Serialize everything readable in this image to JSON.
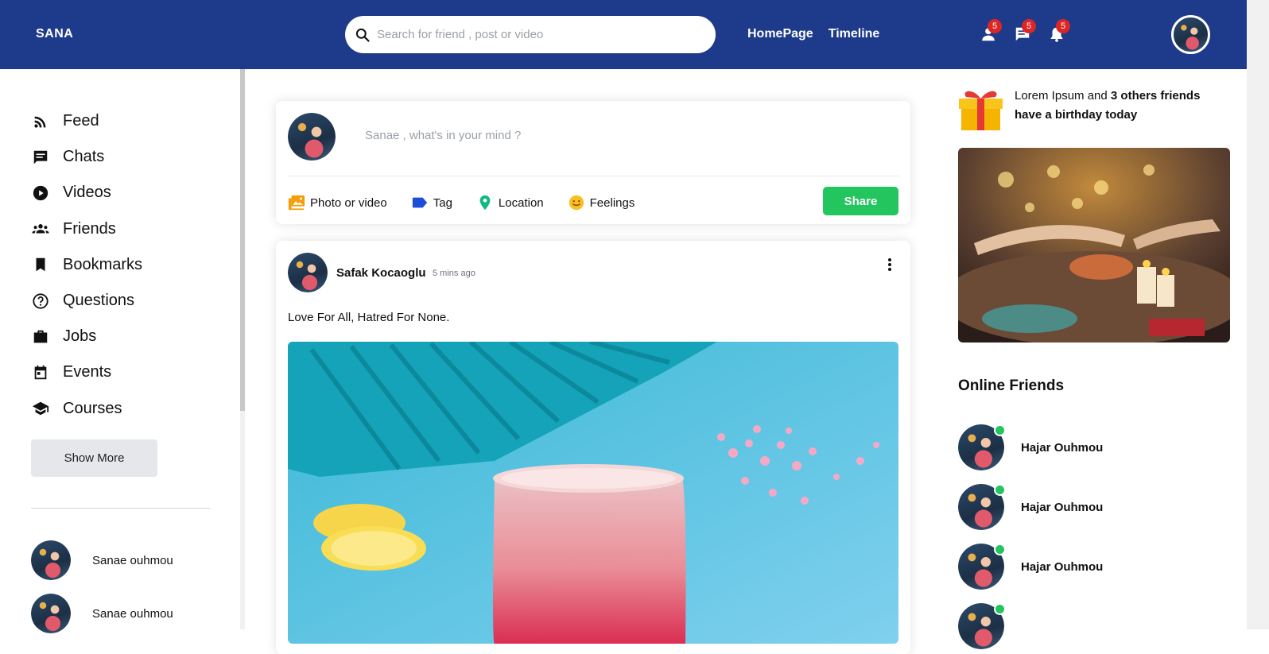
{
  "header": {
    "brand": "SANA",
    "search_placeholder": "Search for friend , post or video",
    "nav": [
      "HomePage",
      "Timeline"
    ],
    "notifications": [
      {
        "icon": "person-icon",
        "count": "5"
      },
      {
        "icon": "chat-icon",
        "count": "5"
      },
      {
        "icon": "bell-icon",
        "count": "5"
      }
    ],
    "colors": {
      "bar": "#1e3a8a",
      "badge": "#dc2626"
    }
  },
  "sidebar": {
    "items": [
      {
        "label": "Feed",
        "icon": "rss-icon"
      },
      {
        "label": "Chats",
        "icon": "chat-icon"
      },
      {
        "label": "Videos",
        "icon": "play-circle-icon"
      },
      {
        "label": "Friends",
        "icon": "group-icon"
      },
      {
        "label": "Bookmarks",
        "icon": "bookmark-icon"
      },
      {
        "label": "Questions",
        "icon": "help-circle-icon"
      },
      {
        "label": "Jobs",
        "icon": "briefcase-icon"
      },
      {
        "label": "Events",
        "icon": "calendar-icon"
      },
      {
        "label": "Courses",
        "icon": "school-icon"
      }
    ],
    "show_more": "Show More",
    "friends": [
      "Sanae ouhmou",
      "Sanae ouhmou"
    ]
  },
  "share": {
    "placeholder": "Sanae , what's in your mind ?",
    "options": [
      {
        "label": "Photo or video",
        "icon": "photo-icon"
      },
      {
        "label": "Tag",
        "icon": "tag-icon"
      },
      {
        "label": "Location",
        "icon": "location-icon"
      },
      {
        "label": "Feelings",
        "icon": "smile-icon"
      }
    ],
    "button": "Share",
    "button_color": "#22c55e"
  },
  "post": {
    "user": "Safak Kocaoglu",
    "time": "5 mins ago",
    "text": "Love For All, Hatred For None."
  },
  "rightbar": {
    "birthday_prefix": "Lorem Ipsum and ",
    "birthday_bold": "3 others friends have a birthday today",
    "online_title": "Online Friends",
    "online_friends": [
      "Hajar Ouhmou",
      "Hajar Ouhmou",
      "Hajar Ouhmou"
    ],
    "online_color": "#22c55e"
  }
}
